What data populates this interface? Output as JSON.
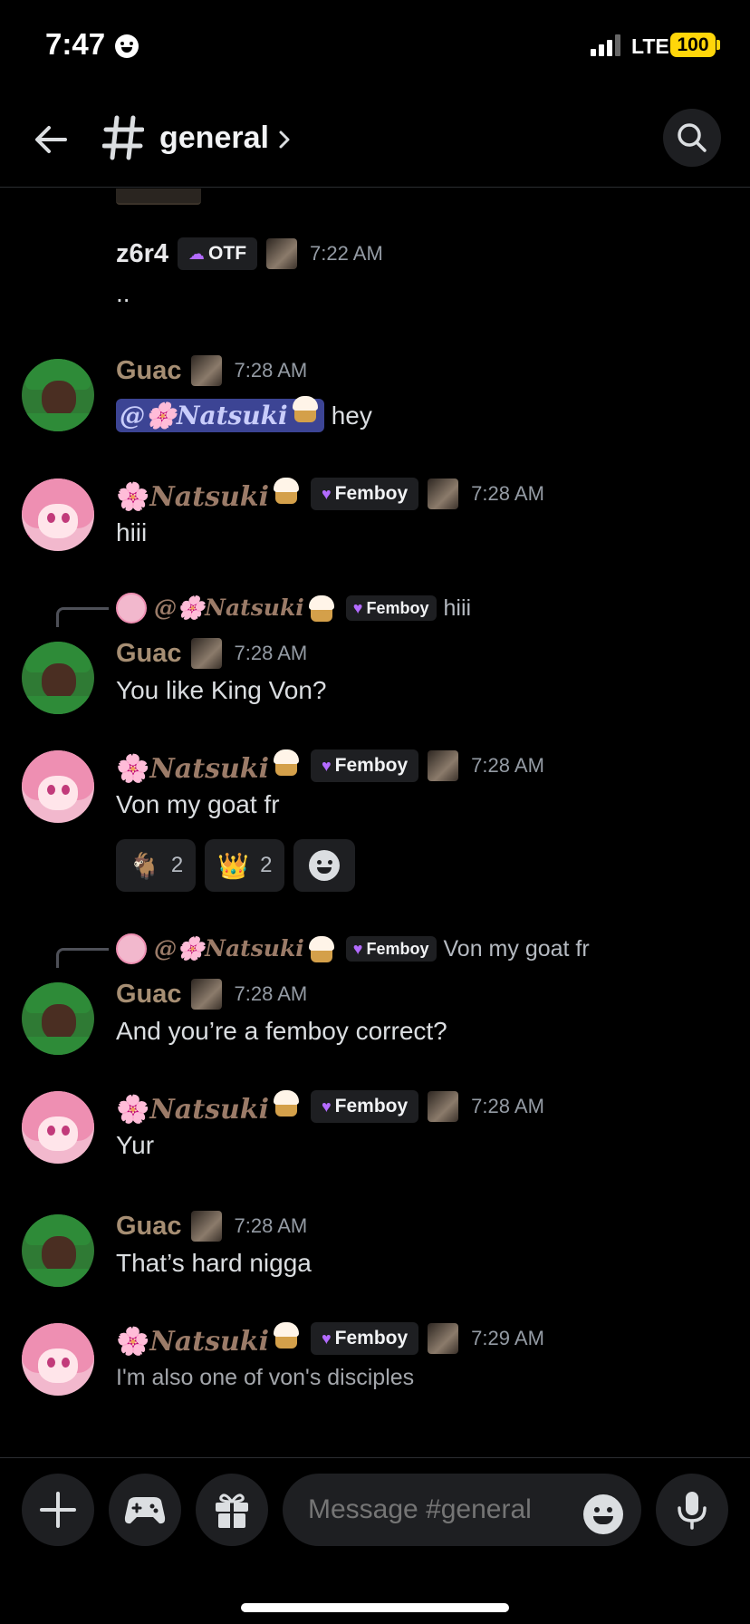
{
  "status_bar": {
    "time": "7:47",
    "network": "LTE",
    "battery": "100"
  },
  "header": {
    "channel_name": "general"
  },
  "messages": {
    "m1": {
      "username": "z6r4",
      "tag": "OTF",
      "timestamp": "7:22 AM",
      "text": ".."
    },
    "m2": {
      "username": "Guac",
      "timestamp": "7:28 AM",
      "mention": "@🌸Natsuki",
      "text": "hey"
    },
    "m3": {
      "username": "Natsuki",
      "tag": "Femboy",
      "timestamp": "7:28 AM",
      "text": "hiii"
    },
    "m4": {
      "reply_name": "@🌸Natsuki",
      "reply_tag": "Femboy",
      "reply_text": "hiii",
      "username": "Guac",
      "timestamp": "7:28 AM",
      "text": "You like King Von?"
    },
    "m5": {
      "username": "Natsuki",
      "tag": "Femboy",
      "timestamp": "7:28 AM",
      "text": "Von my goat fr",
      "reactions": [
        {
          "emoji": "🐐",
          "count": "2"
        },
        {
          "emoji": "👑",
          "count": "2"
        }
      ]
    },
    "m6": {
      "reply_name": "@🌸Natsuki",
      "reply_tag": "Femboy",
      "reply_text": "Von my goat fr",
      "username": "Guac",
      "timestamp": "7:28 AM",
      "text": "And you’re a femboy correct?"
    },
    "m7": {
      "username": "Natsuki",
      "tag": "Femboy",
      "timestamp": "7:28 AM",
      "text": "Yur"
    },
    "m8": {
      "username": "Guac",
      "timestamp": "7:28 AM",
      "text": "That’s hard nigga"
    },
    "m9": {
      "username": "Natsuki",
      "tag": "Femboy",
      "timestamp": "7:29 AM",
      "text": "I'm also one of von's disciples"
    }
  },
  "composer": {
    "placeholder": "Message #general"
  },
  "colors": {
    "background": "#000000",
    "mention_bg": "#3c4494",
    "battery": "#ffd60a",
    "guac_name": "#a68e73",
    "natsuki_name": "#9b7b68"
  },
  "icons": [
    "back-arrow-icon",
    "hash-icon",
    "chevron-right-icon",
    "search-icon",
    "plus-icon",
    "gamepad-icon",
    "gift-icon",
    "emoji-icon",
    "microphone-icon"
  ]
}
